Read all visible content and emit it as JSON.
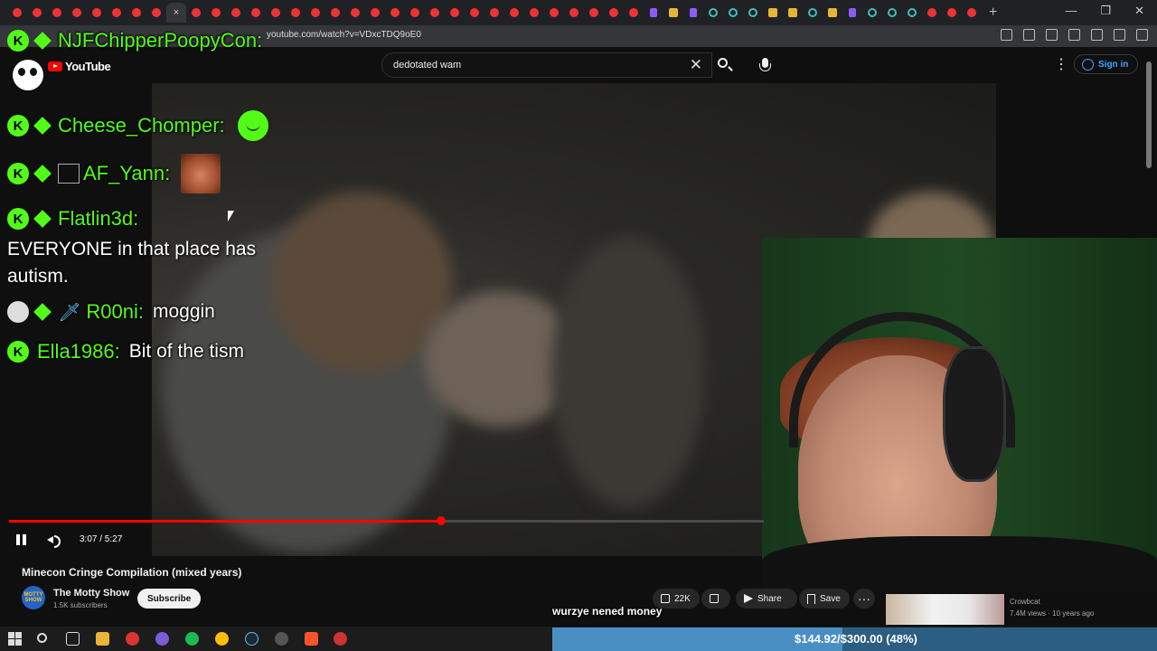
{
  "browser": {
    "url": "youtube.com/watch?v=VDxcTDQ9oE0",
    "active_tab_close": "×",
    "new_tab": "+"
  },
  "youtube": {
    "brand": "YouTube",
    "search_value": "dedotated wam",
    "search_clear": "✕",
    "sign_in": "Sign in",
    "menu_glyph": "⋮"
  },
  "player": {
    "time": "3:07 / 5:27",
    "progress_fraction": 0.572
  },
  "video": {
    "title": "Minecon Cringe Compilation (mixed years)",
    "channel": "The Motty Show",
    "channel_avatar_text": "MOTTY SHOW",
    "subscribers": "1.5K subscribers",
    "subscribe_label": "Subscribe",
    "likes": "22K",
    "share_label": "Share",
    "save_label": "Save",
    "more_glyph": "···"
  },
  "overlay": {
    "top_user": "NJFChipperPoopyCon:",
    "chat": [
      {
        "user": "Cheese_Chomper:",
        "text": ""
      },
      {
        "user": "AF_Yann:",
        "text": ""
      },
      {
        "user": "Flatlin3d:",
        "text": "EVERYONE in that place has autism."
      },
      {
        "user": "R00ni:",
        "text": "moggin"
      },
      {
        "user": "Ella1986:",
        "text": "Bit of the tism"
      }
    ],
    "caption": "wurzye nened money",
    "goal_text": "$144.92/$300.00 (48%)",
    "goal_fraction": 0.48
  },
  "recommendation": {
    "channel": "Crowbcat",
    "meta": "7.4M views · 10 years ago"
  },
  "colors": {
    "kick_green": "#53fc18",
    "yt_red": "#ff0000",
    "link_blue": "#3ea6ff"
  }
}
